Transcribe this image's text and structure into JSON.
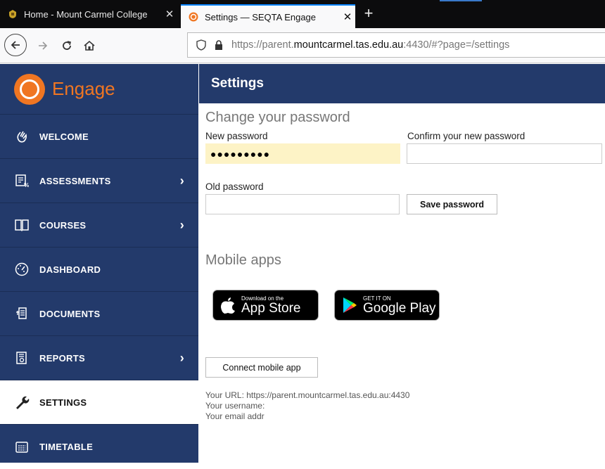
{
  "browser": {
    "tabs": [
      {
        "title": "Home - Mount Carmel College",
        "close": "✕"
      },
      {
        "title": "Settings — SEQTA Engage",
        "close": "✕"
      }
    ],
    "new_tab": "+",
    "url": {
      "prefix": "https://parent.",
      "host": "mountcarmel.tas.edu.au",
      "suffix": ":4430/#?page=/settings"
    }
  },
  "sidebar": {
    "brand": "Engage",
    "items": [
      {
        "label": "WELCOME",
        "icon": "hand-wave-icon"
      },
      {
        "label": "ASSESSMENTS",
        "icon": "assessments-icon",
        "chevron": "›"
      },
      {
        "label": "COURSES",
        "icon": "book-icon",
        "chevron": "›"
      },
      {
        "label": "DASHBOARD",
        "icon": "gauge-icon"
      },
      {
        "label": "DOCUMENTS",
        "icon": "documents-icon"
      },
      {
        "label": "REPORTS",
        "icon": "report-icon",
        "chevron": "›"
      },
      {
        "label": "SETTINGS",
        "icon": "wrench-icon"
      },
      {
        "label": "TIMETABLE",
        "icon": "timetable-icon"
      }
    ]
  },
  "header": {
    "title": "Settings"
  },
  "password": {
    "title": "Change your password",
    "new_label": "New password",
    "new_value": "●●●●●●●●●",
    "confirm_label": "Confirm your new password",
    "confirm_value": "",
    "old_label": "Old password",
    "old_value": "",
    "save_label": "Save password"
  },
  "mobile": {
    "title": "Mobile apps",
    "appstore_small": "Download on the",
    "appstore_big": "App Store",
    "play_small": "GET IT ON",
    "play_big": "Google Play",
    "connect_label": "Connect mobile app",
    "url_line": "Your URL: https://parent.mountcarmel.tas.edu.au:4430",
    "username_line": "Your username:",
    "email_line": "Your email addr"
  },
  "colors": {
    "sidebar": "#233a6b",
    "brand": "#f07622",
    "accent": "#0a84ff"
  }
}
